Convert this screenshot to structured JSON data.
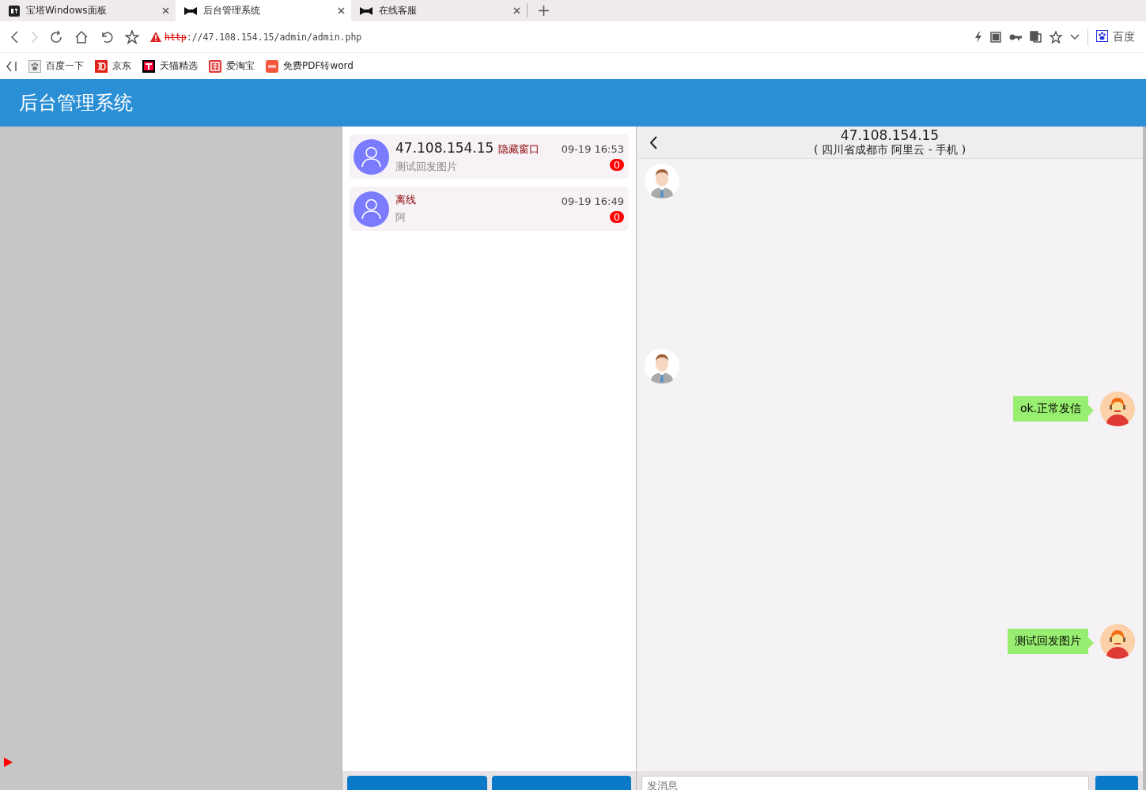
{
  "browser": {
    "tabs": [
      {
        "title": "宝塔Windows面板",
        "selected": false
      },
      {
        "title": "后台管理系统",
        "selected": true
      },
      {
        "title": "在线客服",
        "selected": false
      }
    ],
    "address": {
      "scheme": "http",
      "rest": "://47.108.154.15/admin/admin.php"
    },
    "search_engine": "百度",
    "bookmarks": [
      {
        "label": "百度一下"
      },
      {
        "label": "京东"
      },
      {
        "label": "天猫精选"
      },
      {
        "label": "爱淘宝"
      },
      {
        "label": "免费PDF转word"
      }
    ]
  },
  "header": {
    "title": "后台管理系统"
  },
  "sessions": [
    {
      "name": "47.108.154.15",
      "tag": "隐藏窗口",
      "time": "09-19 16:53",
      "preview": "测试回发图片",
      "unread": "0"
    },
    {
      "tag": "离线",
      "time": "09-19 16:49",
      "preview": "阿",
      "unread": "0"
    }
  ],
  "chat": {
    "title": "47.108.154.15",
    "subtitle": "( 四川省成都市 阿里云 - 手机 )",
    "messages": [
      {
        "kind": "incoming"
      },
      {
        "kind": "incoming"
      },
      {
        "kind": "outgoing",
        "text": "ok.正常发信"
      },
      {
        "kind": "outgoing",
        "text": "测试回发图片"
      }
    ],
    "input": {
      "placeholder": "发消息"
    }
  }
}
